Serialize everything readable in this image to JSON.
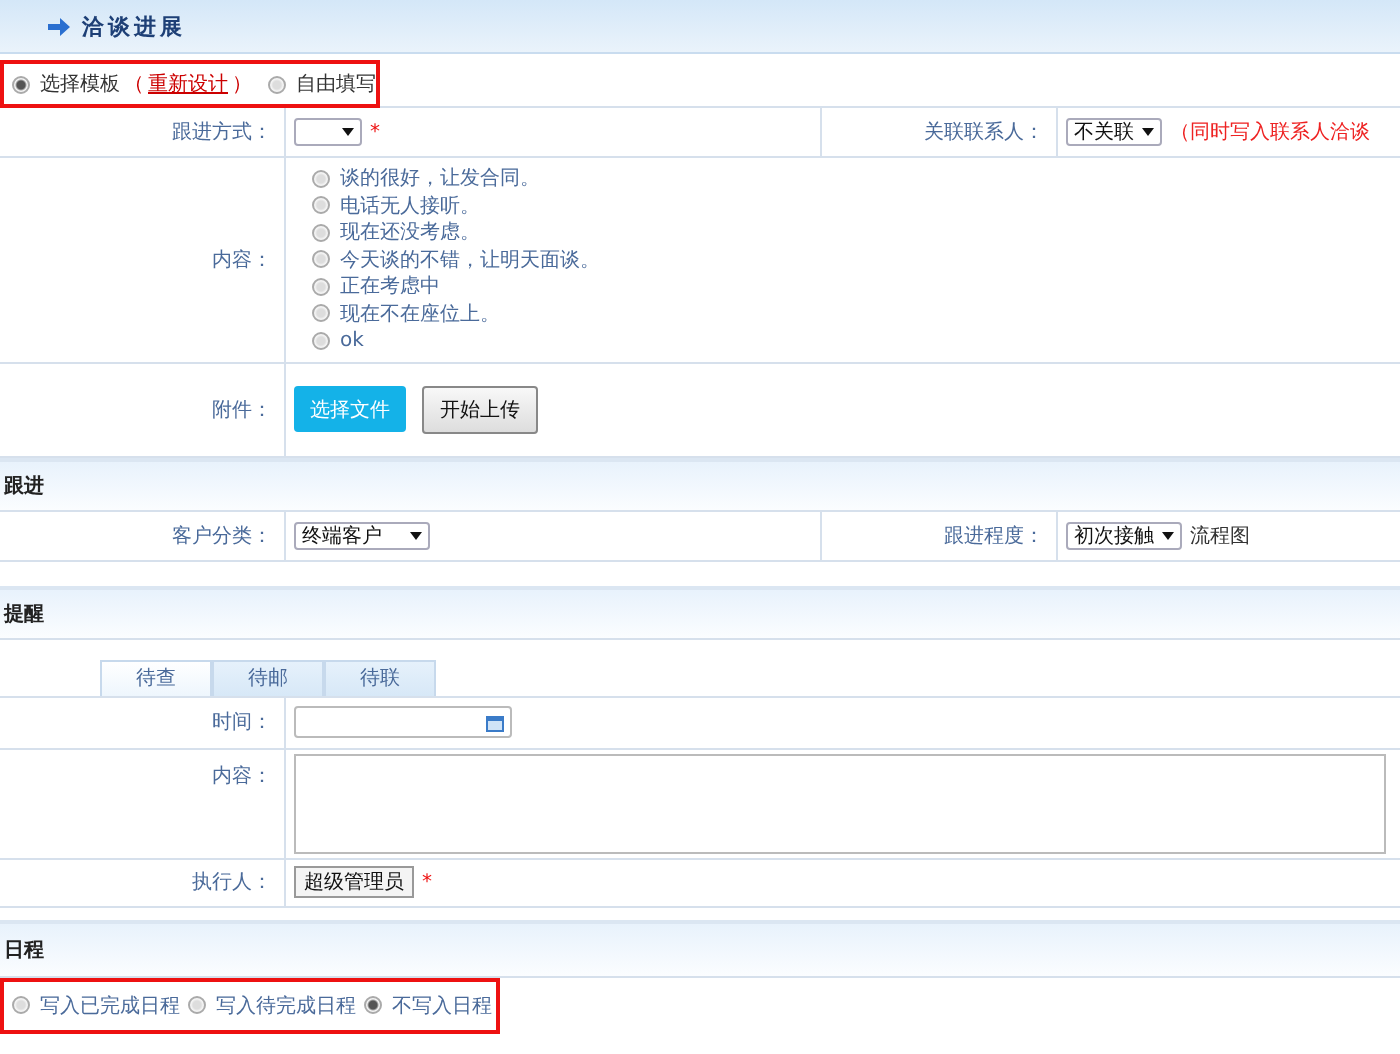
{
  "header": {
    "title": "洽谈进展"
  },
  "mode": {
    "options": [
      {
        "label": "选择模板",
        "selected": true
      },
      {
        "label": "自由填写",
        "selected": false
      }
    ],
    "link_before": "（",
    "link": "重新设计",
    "link_after": "）"
  },
  "follow_method": {
    "label": "跟进方式：",
    "required_mark": "*"
  },
  "contact": {
    "label": "关联联系人：",
    "value": "不关联",
    "note": "（同时写入联系人洽谈"
  },
  "content": {
    "label": "内容：",
    "options": [
      {
        "label": "谈的很好，让发合同。",
        "selected": false
      },
      {
        "label": "电话无人接听。",
        "selected": false
      },
      {
        "label": "现在还没考虑。",
        "selected": false
      },
      {
        "label": "今天谈的不错，让明天面谈。",
        "selected": false
      },
      {
        "label": "正在考虑中",
        "selected": false
      },
      {
        "label": "现在不在座位上。",
        "selected": false
      },
      {
        "label": "ok",
        "selected": false
      }
    ]
  },
  "attachment": {
    "label": "附件：",
    "buttons": [
      {
        "label": "选择文件",
        "kind": "primary"
      },
      {
        "label": "开始上传",
        "kind": "plain"
      }
    ]
  },
  "follow_section": {
    "title": "跟进"
  },
  "customer_category": {
    "label": "客户分类：",
    "value": "终端客户"
  },
  "follow_degree": {
    "label": "跟进程度：",
    "value": "初次接触",
    "link": "流程图"
  },
  "reminder_section": {
    "title": "提醒"
  },
  "tabs": [
    {
      "label": "待查",
      "selected": true
    },
    {
      "label": "待邮",
      "selected": false
    },
    {
      "label": "待联",
      "selected": false
    }
  ],
  "reminder": {
    "time_label": "时间：",
    "content_label": "内容：",
    "executor_label": "执行人：",
    "executor": "超级管理员",
    "required_mark": "*"
  },
  "schedule_section": {
    "title": "日程"
  },
  "schedule_options": [
    {
      "label": "写入已完成日程",
      "selected": false
    },
    {
      "label": "写入待完成日程",
      "selected": false
    },
    {
      "label": "不写入日程",
      "selected": true
    }
  ]
}
